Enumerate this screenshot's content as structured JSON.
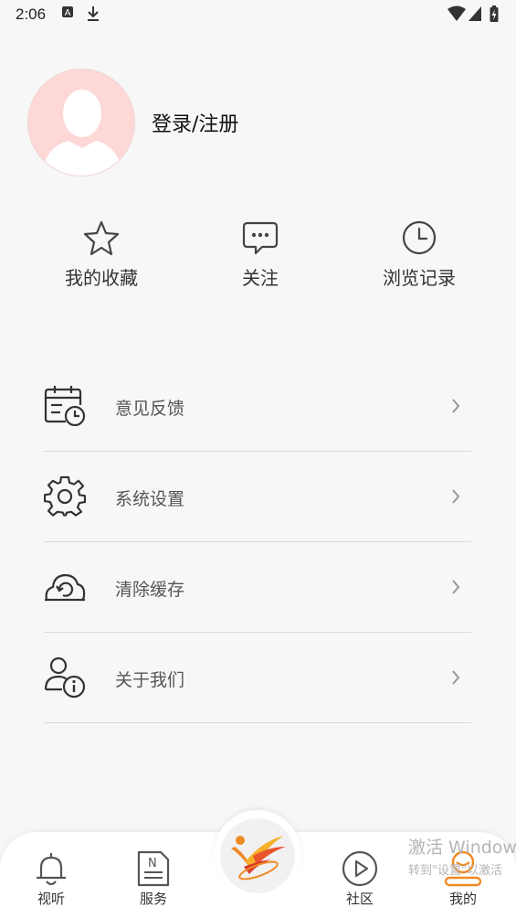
{
  "status_bar": {
    "time": "2:06"
  },
  "profile": {
    "login_label": "登录/注册"
  },
  "quick_actions": [
    {
      "label": "我的收藏",
      "icon": "star-icon"
    },
    {
      "label": "关注",
      "icon": "chat-icon"
    },
    {
      "label": "浏览记录",
      "icon": "clock-icon"
    }
  ],
  "menu": [
    {
      "label": "意见反馈",
      "icon": "calendar-clock-icon"
    },
    {
      "label": "系统设置",
      "icon": "gear-icon"
    },
    {
      "label": "清除缓存",
      "icon": "cloud-refresh-icon"
    },
    {
      "label": "关于我们",
      "icon": "user-info-icon"
    }
  ],
  "tabs": [
    {
      "label": "视听",
      "icon": "bell-icon"
    },
    {
      "label": "服务",
      "icon": "news-icon"
    },
    {
      "label": "",
      "icon": "logo-icon"
    },
    {
      "label": "社区",
      "icon": "play-icon"
    },
    {
      "label": "我的",
      "icon": "user-icon"
    }
  ],
  "colors": {
    "accent": "#f08a24",
    "avatar_bg": "#fdd8d6",
    "background": "#f7f7f7"
  },
  "watermark": {
    "line1": "激活 Windows",
    "line2": "转到\"设置\"以激活"
  }
}
